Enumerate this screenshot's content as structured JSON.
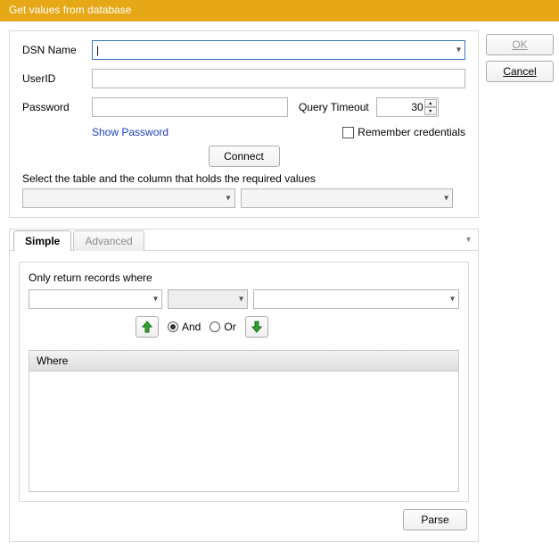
{
  "title": "Get values from database",
  "buttons": {
    "ok": "OK",
    "cancel": "Cancel",
    "connect": "Connect",
    "parse": "Parse"
  },
  "form": {
    "dsn_label": "DSN Name",
    "dsn_value": "|",
    "user_label": "UserID",
    "user_value": "",
    "pass_label": "Password",
    "pass_value": "",
    "timeout_label": "Query Timeout",
    "timeout_value": "30",
    "show_password": "Show Password",
    "remember": "Remember credentials"
  },
  "select_hint": "Select the table and the column that holds the required values",
  "tabs": {
    "simple": "Simple",
    "advanced": "Advanced"
  },
  "filter": {
    "heading": "Only return records where",
    "and": "And",
    "or": "Or",
    "where_col": "Where"
  }
}
